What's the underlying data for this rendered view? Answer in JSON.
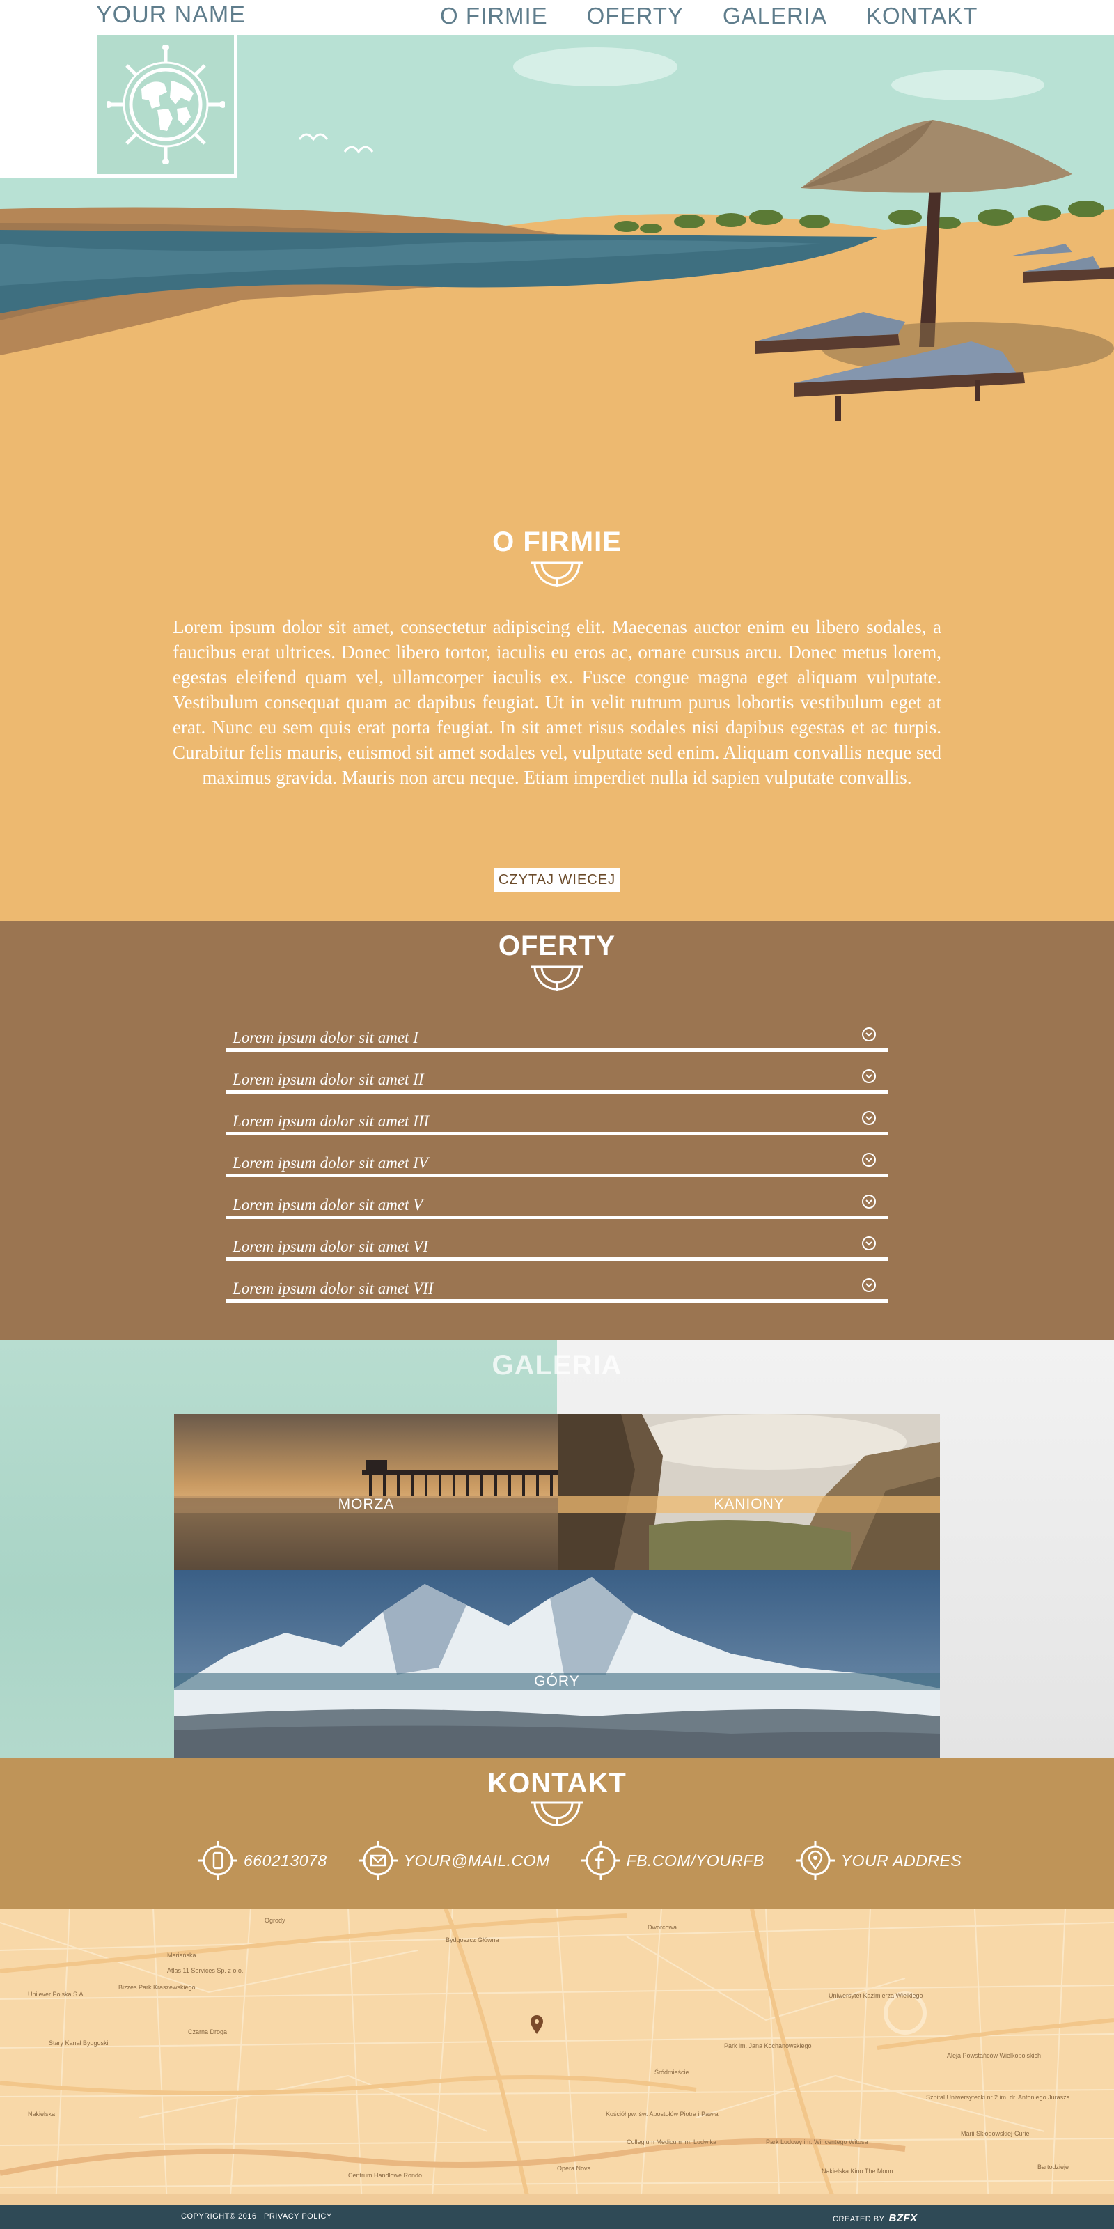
{
  "header": {
    "brand": "YOUR NAME",
    "nav": [
      "O FIRMIE",
      "OFERTY",
      "GALERIA",
      "KONTAKT"
    ]
  },
  "about": {
    "title": "O FIRMIE",
    "text": "Lorem ipsum dolor sit amet, consectetur adipiscing elit. Maecenas auctor enim eu libero sodales, a faucibus erat ultrices. Donec libero tortor, iaculis eu eros ac, ornare cursus arcu. Donec metus lorem, egestas eleifend quam vel, ullamcorper iaculis ex. Fusce congue magna eget aliquam vulputate. Vestibulum consequat quam ac dapibus feugiat. Ut in velit rutrum purus lobortis vestibulum eget at erat. Nunc eu sem quis erat porta feugiat. In sit amet risus sodales nisi dapibus egestas et ac turpis. Curabitur felis mauris, euismod sit amet sodales vel, vulputate sed enim. Aliquam convallis neque sed maximus gravida. Mauris non arcu neque. Etiam imperdiet nulla id sapien vulputate convallis.",
    "button": "CZYTAJ WIECEJ"
  },
  "offers": {
    "title": "OFERTY",
    "items": [
      "Lorem ipsum dolor sit amet I",
      "Lorem ipsum dolor sit amet II",
      "Lorem ipsum dolor sit amet III",
      "Lorem ipsum dolor sit amet IV",
      "Lorem ipsum dolor sit amet V",
      "Lorem ipsum dolor sit amet VI",
      "Lorem ipsum dolor sit amet VII"
    ]
  },
  "gallery": {
    "title": "GALERIA",
    "tiles": [
      "MORZA",
      "KANIONY",
      "GÓRY"
    ]
  },
  "contact": {
    "title": "KONTAKT",
    "phone": "660213078",
    "email": "YOUR@MAIL.COM",
    "facebook": "FB.COM/YOURFB",
    "address": "YOUR ADDRES"
  },
  "map": {
    "labels": [
      "Bydgoszcz Główna",
      "Mariańska",
      "Ogrody",
      "Dworcowa",
      "Atlas 11 Services Sp. z o.o.",
      "Unilever Polska S.A.",
      "Bizzes Park Kraszewskiego",
      "Stary Kanał Bydgoski",
      "Czarna Droga",
      "Nakielska",
      "Uniwersytet Kazimierza Wielkiego",
      "Park im. Jana Kochanowskiego",
      "Kościół pw. św. Apostołów Piotra i Pawła",
      "Collegium Medicum im. Ludwika",
      "Opera Nova",
      "Centrum Handlowe Rondo",
      "Park Ludowy im. Wincentego Witosa",
      "Szpital Uniwersytecki nr 2 im. dr. Antoniego Jurasza",
      "Aleja Powstańców Wielkopolskich",
      "Marii Skłodowskiej-Curie",
      "Śródmieście",
      "Bartodzieje",
      "Nakielska Kino The Moon"
    ]
  },
  "footer": {
    "copyright": "COPYRIGHT© 2016 | PRIVACY POLICY",
    "credit": "CREATED BY",
    "credit_logo": "BZFX"
  },
  "colors": {
    "accent_teal": "#5f7d8c",
    "sand": "#edb970",
    "brown": "#9b7551",
    "contact": "#bf9458",
    "footer": "#2f4a56"
  }
}
